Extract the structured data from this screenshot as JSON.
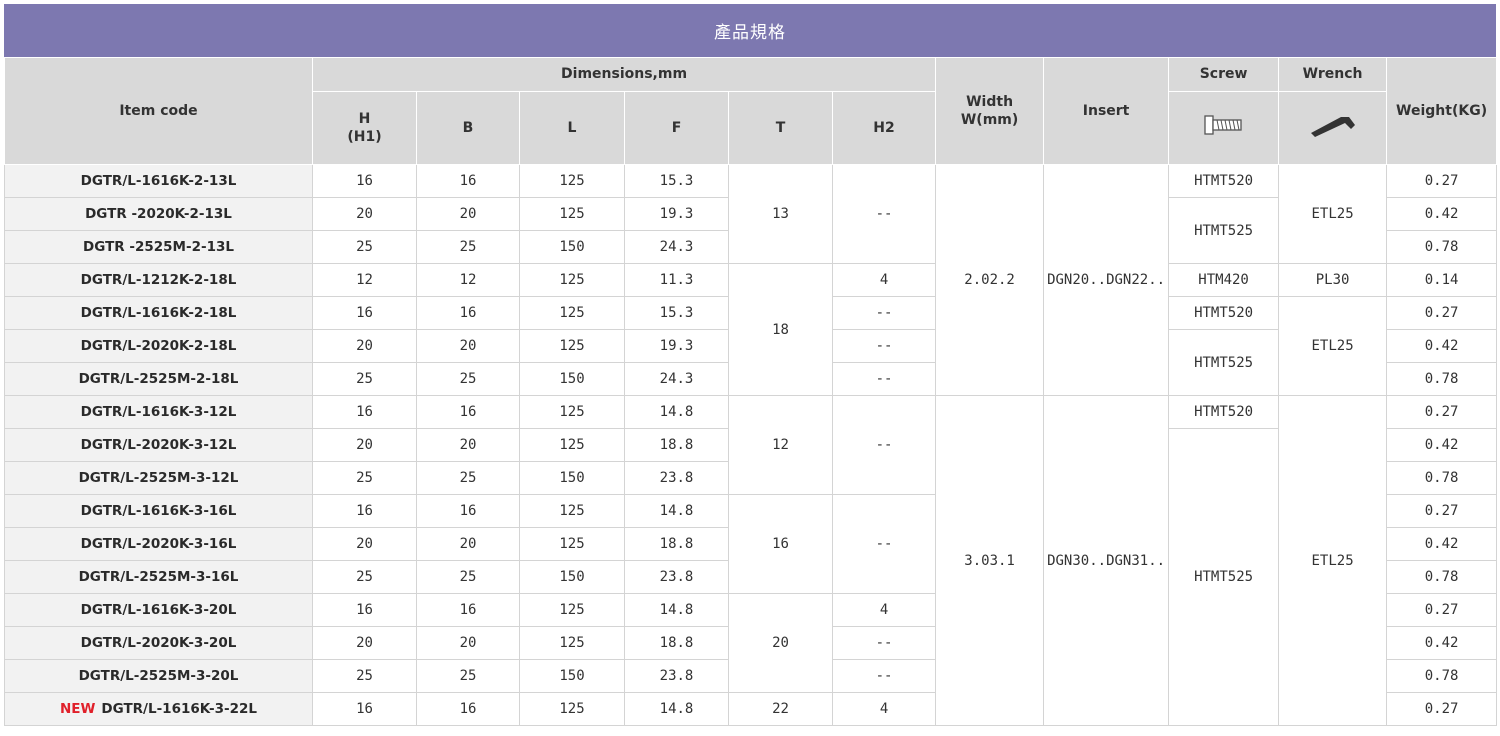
{
  "title": "產品規格",
  "header": {
    "item_code": "Item code",
    "dimensions": "Dimensions,mm",
    "h": "H",
    "h1": "(H1)",
    "b": "B",
    "l": "L",
    "f": "F",
    "t": "T",
    "h2": "H2",
    "width_line1": "Width",
    "width_line2": "W(mm)",
    "insert": "Insert",
    "screw": "Screw",
    "wrench": "Wrench",
    "weight": "Weight(KG)",
    "screw_icon": "screw-icon",
    "wrench_icon": "hex-key-icon"
  },
  "new_label": "NEW",
  "groups": [
    {
      "width": "2.02.2",
      "insert": "DGN20..DGN22.."
    },
    {
      "width": "3.03.1",
      "insert": "DGN30..DGN31.."
    }
  ],
  "t_groups": [
    {
      "t": "13"
    },
    {
      "t": "18"
    },
    {
      "t": "12"
    },
    {
      "t": "16"
    },
    {
      "t": "20"
    },
    {
      "t": "22"
    }
  ],
  "h2_groups": [
    {
      "h2": "--"
    },
    {
      "h2": "4"
    },
    {
      "h2": "--"
    },
    {
      "h2": "--"
    },
    {
      "h2": "--"
    },
    {
      "h2": "--"
    },
    {
      "h2": "--"
    },
    {
      "h2": "4"
    },
    {
      "h2": "--"
    },
    {
      "h2": "--"
    },
    {
      "h2": "4"
    }
  ],
  "screw_groups": [
    {
      "screw": "HTMT520"
    },
    {
      "screw": "HTMT525"
    },
    {
      "screw": "HTM420"
    },
    {
      "screw": "HTMT520"
    },
    {
      "screw": "HTMT525"
    },
    {
      "screw": "HTMT520"
    },
    {
      "screw": "HTMT525"
    }
  ],
  "wrench_groups": [
    {
      "wrench": "ETL25"
    },
    {
      "wrench": "PL30"
    },
    {
      "wrench": "ETL25"
    },
    {
      "wrench": "ETL25"
    }
  ],
  "rows": [
    {
      "code": "DGTR/L-1616K-2-13L",
      "h": "16",
      "b": "16",
      "l": "125",
      "f": "15.3",
      "weight": "0.27"
    },
    {
      "code": "DGTR -2020K-2-13L",
      "h": "20",
      "b": "20",
      "l": "125",
      "f": "19.3",
      "weight": "0.42"
    },
    {
      "code": "DGTR -2525M-2-13L",
      "h": "25",
      "b": "25",
      "l": "150",
      "f": "24.3",
      "weight": "0.78"
    },
    {
      "code": "DGTR/L-1212K-2-18L",
      "h": "12",
      "b": "12",
      "l": "125",
      "f": "11.3",
      "weight": "0.14"
    },
    {
      "code": "DGTR/L-1616K-2-18L",
      "h": "16",
      "b": "16",
      "l": "125",
      "f": "15.3",
      "weight": "0.27"
    },
    {
      "code": "DGTR/L-2020K-2-18L",
      "h": "20",
      "b": "20",
      "l": "125",
      "f": "19.3",
      "weight": "0.42"
    },
    {
      "code": "DGTR/L-2525M-2-18L",
      "h": "25",
      "b": "25",
      "l": "150",
      "f": "24.3",
      "weight": "0.78"
    },
    {
      "code": "DGTR/L-1616K-3-12L",
      "h": "16",
      "b": "16",
      "l": "125",
      "f": "14.8",
      "weight": "0.27"
    },
    {
      "code": "DGTR/L-2020K-3-12L",
      "h": "20",
      "b": "20",
      "l": "125",
      "f": "18.8",
      "weight": "0.42"
    },
    {
      "code": "DGTR/L-2525M-3-12L",
      "h": "25",
      "b": "25",
      "l": "150",
      "f": "23.8",
      "weight": "0.78"
    },
    {
      "code": "DGTR/L-1616K-3-16L",
      "h": "16",
      "b": "16",
      "l": "125",
      "f": "14.8",
      "weight": "0.27"
    },
    {
      "code": "DGTR/L-2020K-3-16L",
      "h": "20",
      "b": "20",
      "l": "125",
      "f": "18.8",
      "weight": "0.42"
    },
    {
      "code": "DGTR/L-2525M-3-16L",
      "h": "25",
      "b": "25",
      "l": "150",
      "f": "23.8",
      "weight": "0.78"
    },
    {
      "code": "DGTR/L-1616K-3-20L",
      "h": "16",
      "b": "16",
      "l": "125",
      "f": "14.8",
      "weight": "0.27"
    },
    {
      "code": "DGTR/L-2020K-3-20L",
      "h": "20",
      "b": "20",
      "l": "125",
      "f": "18.8",
      "weight": "0.42"
    },
    {
      "code": "DGTR/L-2525M-3-20L",
      "h": "25",
      "b": "25",
      "l": "150",
      "f": "23.8",
      "weight": "0.78"
    },
    {
      "code": "DGTR/L-1616K-3-22L",
      "h": "16",
      "b": "16",
      "l": "125",
      "f": "14.8",
      "weight": "0.27"
    }
  ],
  "colors": {
    "title_bar": "#7d78b0",
    "header_bg": "#d9d9d9",
    "code_bg": "#f2f2f2",
    "new_tag": "#e0202a"
  }
}
